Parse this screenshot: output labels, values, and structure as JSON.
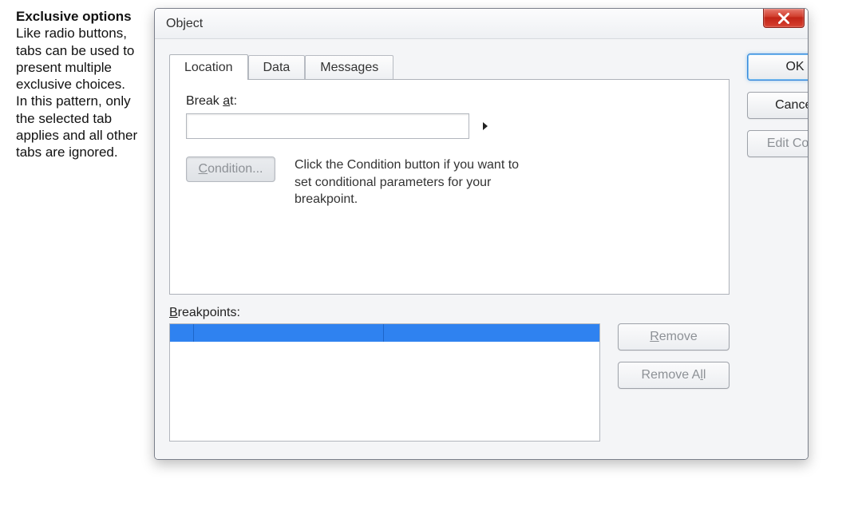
{
  "sidenote": {
    "heading": "Exclusive options",
    "body": "Like radio buttons, tabs can be used to present multiple exclusive choices. In this pattern, only the selected tab applies and all other tabs are ignored."
  },
  "dialog": {
    "title": "Object",
    "tabs": [
      {
        "label": "Location",
        "active": true
      },
      {
        "label": "Data",
        "active": false
      },
      {
        "label": "Messages",
        "active": false
      }
    ],
    "break_at_label": "Break at:",
    "break_at_value": "",
    "condition_button": "Condition...",
    "helper_text": "Click the Condition button if you want to set conditional parameters for your breakpoint.",
    "breakpoints_label": "Breakpoints:",
    "buttons": {
      "ok": "OK",
      "cancel": "Cancel",
      "edit_code": "Edit Code",
      "remove": "Remove",
      "remove_all": "Remove All"
    }
  }
}
